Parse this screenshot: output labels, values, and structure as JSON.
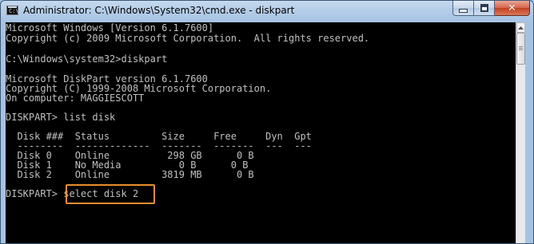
{
  "window": {
    "title": "Administrator: C:\\Windows\\System32\\cmd.exe - diskpart",
    "icon": "cmd-icon",
    "icon_text": "C:\\",
    "minimize_glyph": "",
    "maximize_glyph": "",
    "close_glyph": "✕"
  },
  "console": {
    "lines": [
      "Microsoft Windows [Version 6.1.7600]",
      "Copyright (c) 2009 Microsoft Corporation.  All rights reserved.",
      "",
      "C:\\Windows\\system32>diskpart",
      "",
      "Microsoft DiskPart version 6.1.7600",
      "Copyright (C) 1999-2008 Microsoft Corporation.",
      "On computer: MAGGIESCOTT",
      "",
      "DISKPART> list disk",
      "",
      "  Disk ###  Status         Size     Free     Dyn  Gpt",
      "  --------  -------------  -------  -------  ---  ---",
      "  Disk 0    Online          298 GB      0 B",
      "  Disk 1    No Media          0 B      0 B",
      "  Disk 2    Online         3819 MB      0 B",
      "",
      "DISKPART> select disk 2"
    ],
    "highlighted_command": "select disk 2",
    "highlight_color": "#e88e2e",
    "text_color": "#c0c0c0",
    "background_color": "#000000"
  },
  "scrollbar": {
    "up_arrow_icon": "chevron-up-icon"
  }
}
